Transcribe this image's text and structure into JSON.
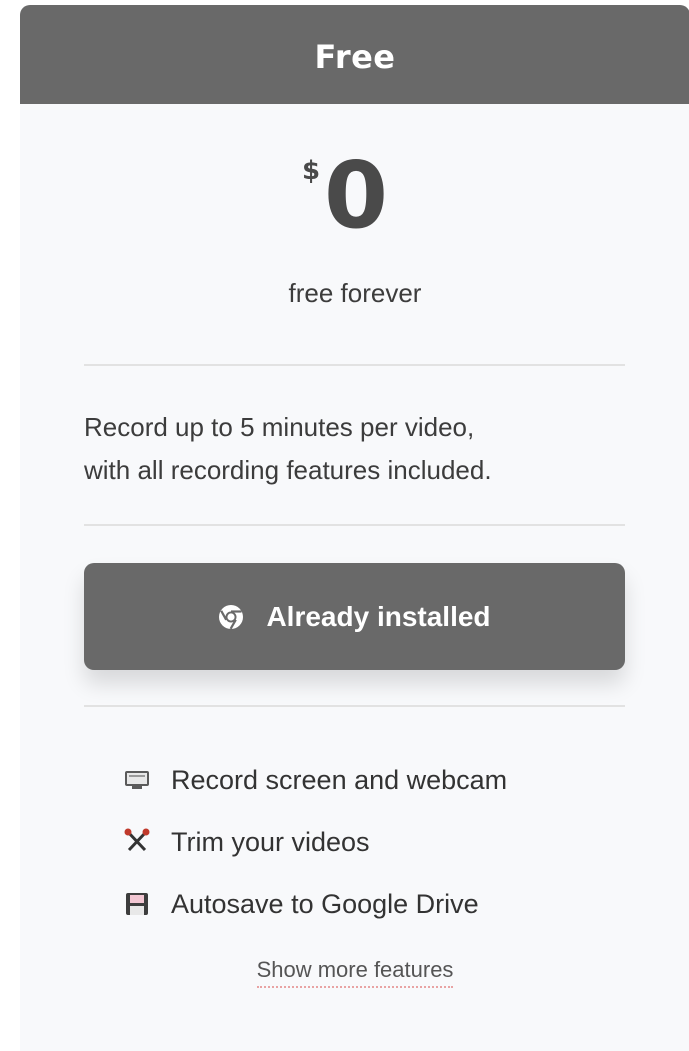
{
  "plan": {
    "name": "Free",
    "currency": "$",
    "price": "0",
    "period": "free forever",
    "description_line1": "Record up to 5 minutes per video,",
    "description_line2": "with all recording features included.",
    "cta_label": "Already installed",
    "cta_icon": "chrome-icon"
  },
  "features": [
    {
      "icon": "screen-webcam-icon",
      "label": "Record screen and webcam"
    },
    {
      "icon": "scissors-icon",
      "label": "Trim your videos"
    },
    {
      "icon": "floppy-disk-icon",
      "label": "Autosave to Google Drive"
    }
  ],
  "show_more_label": "Show more features",
  "colors": {
    "header": "#696969",
    "card_bg": "#f8f9fb",
    "button": "#696969",
    "link_underline": "#e8a3a3"
  }
}
